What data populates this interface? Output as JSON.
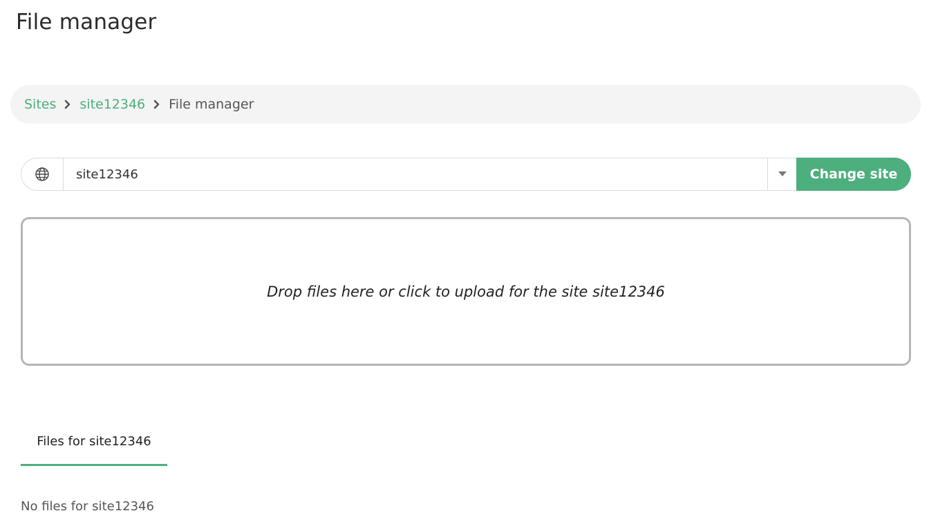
{
  "page": {
    "title": "File manager"
  },
  "breadcrumb": {
    "items": [
      {
        "label": "Sites"
      },
      {
        "label": "site12346"
      },
      {
        "label": "File manager"
      }
    ]
  },
  "site_selector": {
    "value": "site12346",
    "change_button_label": "Change site",
    "globe_icon": "globe-icon",
    "caret_icon": "caret-down-icon"
  },
  "dropzone": {
    "text": "Drop files here or click to upload for the site site12346"
  },
  "tabs": [
    {
      "label": "Files for site12346",
      "active": true
    }
  ],
  "files": {
    "empty_message": "No files for site12346"
  },
  "colors": {
    "accent": "#4caf7d",
    "breadcrumb_bg": "#f4f4f4",
    "dropzone_border": "#b5b5b5"
  }
}
